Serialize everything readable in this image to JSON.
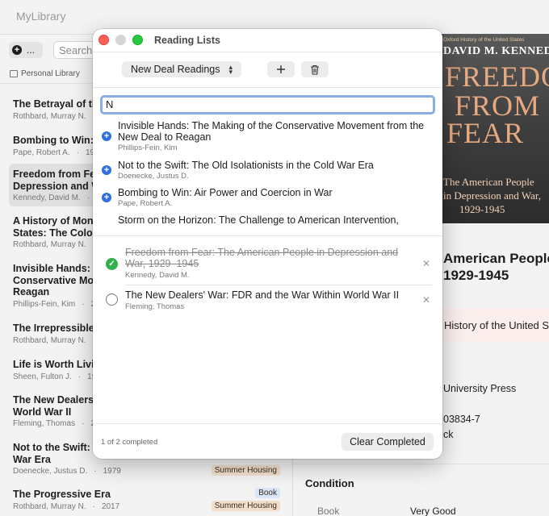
{
  "app": {
    "title": "MyLibrary",
    "add_label": "...",
    "search_placeholder": "Search...",
    "library_label": "Personal Library"
  },
  "books": [
    {
      "title": "The Betrayal of th",
      "author": "Rothbard, Murray N.",
      "year": "",
      "tag": ""
    },
    {
      "title": "Bombing to Win: A",
      "author": "Pape, Robert A.",
      "year": "19",
      "tag": ""
    },
    {
      "title": "Freedom from Fea\nDepression and W",
      "author": "Kennedy, David M.",
      "year": "19",
      "tag": ""
    },
    {
      "title": "A History of Mone\nStates: The Color",
      "author": "Rothbard, Murray N.",
      "year": "",
      "tag": ""
    },
    {
      "title": "Invisible Hands: T\nConservative Mov\nReagan",
      "author": "Phillips-Fein, Kim",
      "year": "2",
      "tag": ""
    },
    {
      "title": "The Irrepressible",
      "author": "Rothbard, Murray N.",
      "year": "",
      "tag": ""
    },
    {
      "title": "Life is Worth Livin",
      "author": "Sheen, Fulton J.",
      "year": "19",
      "tag": ""
    },
    {
      "title": "The New Dealers'\nWorld War II",
      "author": "Fleming, Thomas",
      "year": "2",
      "tag": ""
    },
    {
      "title": "Not to the Swift: \nWar Era",
      "author": "Doenecke, Justus D.",
      "year": "1979",
      "tag": "Summer Housing"
    },
    {
      "title": "The Progressive Era",
      "author": "Rothbard, Murray N.",
      "year": "2017",
      "tag": "Summer Housing",
      "badge": "Book"
    }
  ],
  "detail": {
    "cover_top": "Oxford History of the United States",
    "cover_author": "DAVID M. KENNEDY",
    "cover_word1": "FREEDOM",
    "cover_word2": "FROM",
    "cover_word3": "FEAR",
    "cover_sub1": "The American People",
    "cover_sub2": "in Depression and War,",
    "cover_sub3": "1929-1945",
    "title_line1": "American People",
    "title_line2": "1929-1945",
    "series": "History of the United Sta",
    "publisher": "University Press",
    "isbn": "03834-7",
    "format": "ck",
    "condition_heading": "Condition",
    "condition_label": "Book",
    "condition_value": "Very Good"
  },
  "dialog": {
    "title": "Reading Lists",
    "selected_list": "New Deal Readings",
    "search_value": "N",
    "suggestions": [
      {
        "title": "Invisible Hands: The Making of the Conservative Movement from the New Deal to Reagan",
        "author": "Phillips-Fein, Kim"
      },
      {
        "title": "Not to the Swift: The Old Isolationists in the Cold War Era",
        "author": "Doenecke, Justus D."
      },
      {
        "title": "Bombing to Win: Air Power and Coercion in War",
        "author": "Pape, Robert A."
      },
      {
        "title": "Storm on the Horizon: The Challenge to American Intervention,",
        "author": ""
      }
    ],
    "items": [
      {
        "title": "Freedom from Fear: The American People in Depression and War, 1929–1945",
        "author": "Kennedy, David M.",
        "completed": true
      },
      {
        "title": "The New Dealers' War: FDR and the War Within World War II",
        "author": "Fleming, Thomas",
        "completed": false
      }
    ],
    "progress_text": "1 of 2 completed",
    "clear_label": "Clear Completed"
  },
  "colors": {
    "accent": "#2f6fe0",
    "complete_green": "#30b14c",
    "tag_bg": "#f1dfcc",
    "focus_ring": "#89aee6"
  }
}
